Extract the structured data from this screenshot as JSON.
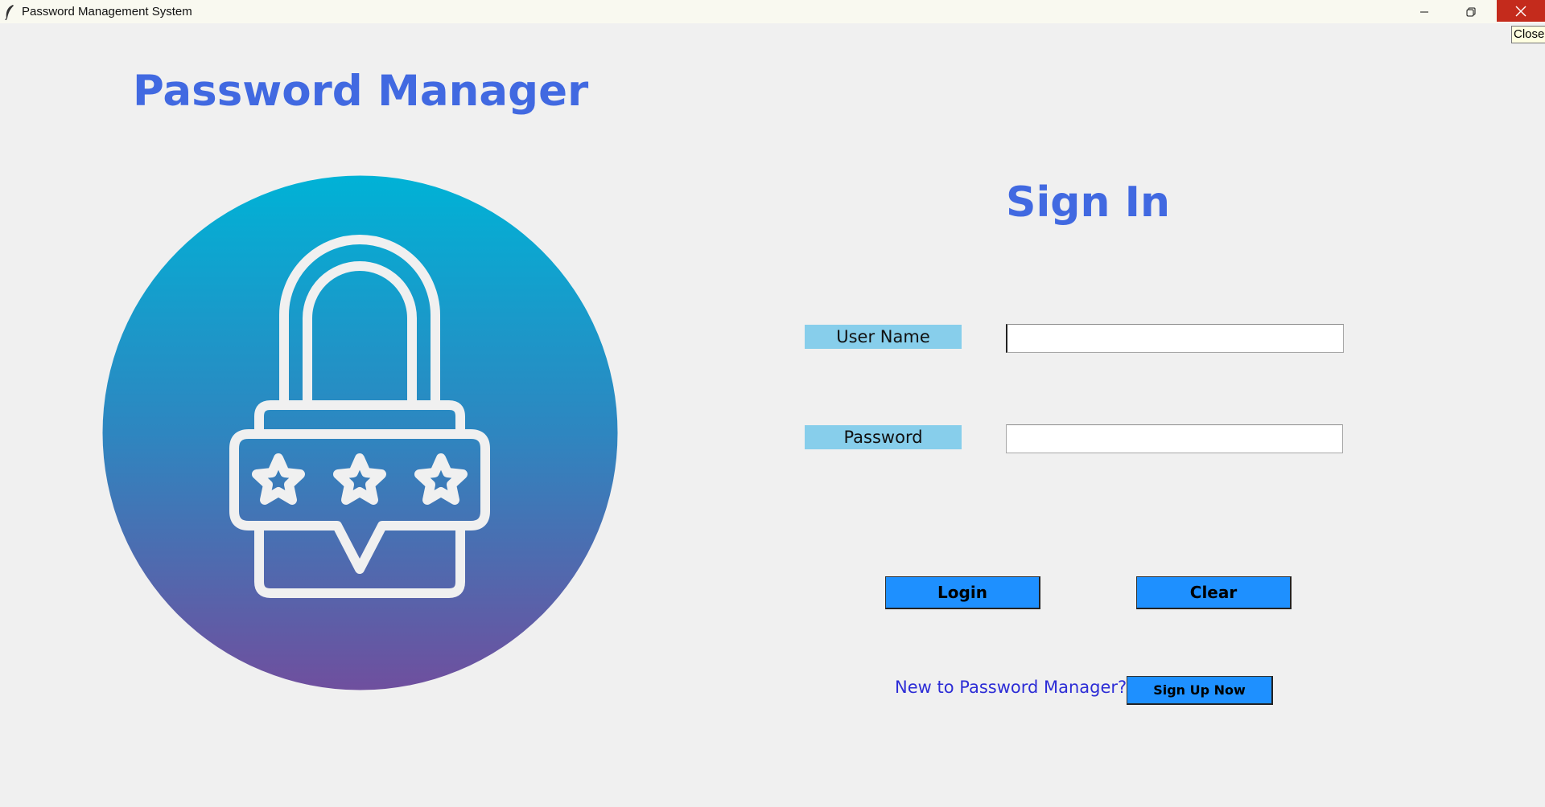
{
  "window": {
    "title": "Password Management System",
    "tooltip": "Close"
  },
  "header": {
    "app_title": "Password Manager"
  },
  "form": {
    "heading": "Sign In",
    "username_label": "User Name",
    "username_value": "",
    "password_label": "Password",
    "password_value": "",
    "login_label": "Login",
    "clear_label": "Clear",
    "new_user_prompt": "New to Password Manager?",
    "signup_label": "Sign Up Now"
  },
  "colors": {
    "accent": "#4169e1",
    "button": "#1e90ff",
    "label_bg": "#87ceeb",
    "link_text": "#2d2dd6",
    "gradient_top": "#00b2d6",
    "gradient_bottom": "#6f4f9e",
    "close_button": "#c42b1c"
  },
  "icons": {
    "app": "feather-icon",
    "minimize": "minimize-icon",
    "restore": "restore-icon",
    "close": "close-icon",
    "logo": "padlock-stars-icon"
  }
}
